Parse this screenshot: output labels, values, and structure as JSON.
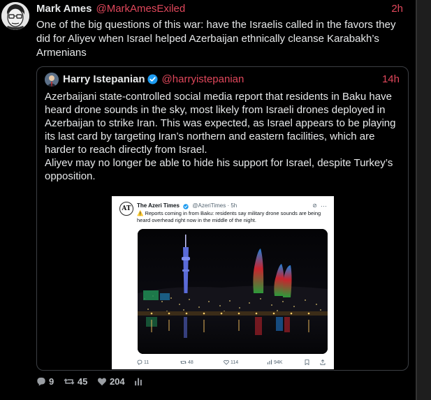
{
  "post": {
    "author_name": "Mark Ames",
    "author_handle": "@MarkAmesExiled",
    "time": "2h",
    "text": "One of the big questions of this war: have the Israelis called in the favors they did for Aliyev when Israel helped Azerbaijan ethnically cleanse Karabakh’s Armenians",
    "avatar_icon": "cartoon-face-avatar"
  },
  "quote": {
    "author_name": "Harry Istepanian",
    "author_handle": "@harryistepanian",
    "time": "14h",
    "verified_icon": "verified-badge-icon",
    "paragraph1": "Azerbaijani state-controlled social media report that residents in Baku have heard drone sounds in the sky, most likely from Israeli drones deployed in Azerbaijan to strike Iran. This was expected, as Israel appears to be playing its last card by targeting Iran’s northern and eastern facilities, which are harder to reach directly from Israel.",
    "paragraph2": "Aliyev may no longer be able to hide his support for Israel, despite Turkey’s opposition.",
    "embed": {
      "logo_text": "AT",
      "name": "The Azeri Times",
      "handle": "@AzeriTimes · 5h",
      "warning_icon": "warning-icon",
      "text": "Reports coming in from Baku: residents say military drone sounds are being heard overhead right now in the middle of the night.",
      "photo": "baku-night-skyline-photo",
      "replies": "11",
      "reposts": "48",
      "likes": "114",
      "views": "94K"
    }
  },
  "stats": {
    "replies": "9",
    "reposts": "45",
    "likes": "204"
  },
  "colors": {
    "accent": "#e0475b",
    "background": "#000000",
    "text": "#e7e9ea",
    "border": "#3c3f44"
  }
}
